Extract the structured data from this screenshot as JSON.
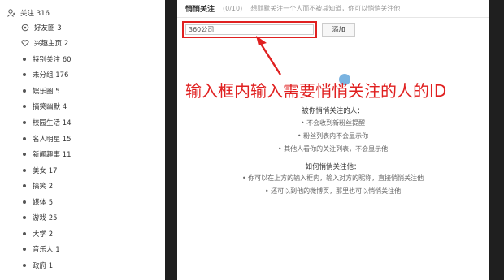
{
  "sidebar": {
    "top": {
      "label": "关注 316",
      "icon": "user-icon"
    },
    "items": [
      {
        "label": "好友圈 3",
        "icon": "circle-icon"
      },
      {
        "label": "兴趣主页 2",
        "icon": "heart-icon"
      },
      {
        "label": "特别关注 60",
        "icon": "dot-icon"
      },
      {
        "label": "未分组 176",
        "icon": "dot-icon"
      },
      {
        "label": "娱乐圈 5",
        "icon": "dot-icon"
      },
      {
        "label": "搞笑幽默 4",
        "icon": "dot-icon"
      },
      {
        "label": "校园生活 14",
        "icon": "dot-icon"
      },
      {
        "label": "名人明星 15",
        "icon": "dot-icon"
      },
      {
        "label": "新闻趣事 11",
        "icon": "dot-icon"
      },
      {
        "label": "美女 17",
        "icon": "dot-icon"
      },
      {
        "label": "搞笑 2",
        "icon": "dot-icon"
      },
      {
        "label": "媒体 5",
        "icon": "dot-icon"
      },
      {
        "label": "游戏 25",
        "icon": "dot-icon"
      },
      {
        "label": "大学 2",
        "icon": "dot-icon"
      },
      {
        "label": "音乐人 1",
        "icon": "dot-icon"
      },
      {
        "label": "政府 1",
        "icon": "dot-icon"
      }
    ]
  },
  "header": {
    "title": "悄悄关注",
    "count": "(0/10)",
    "desc": "想默默关注一个人而不被其知道，你可以悄悄关注他"
  },
  "input": {
    "value": "360公司"
  },
  "add_button": "添加",
  "annotation": "输入框内输入需要悄悄关注的人的ID",
  "info": {
    "heading1": "被你悄悄关注的人：",
    "lines1": [
      "• 不会收到新粉丝提醒",
      "• 粉丝列表内不会显示你",
      "• 其他人看你的关注列表，不会显示他"
    ],
    "heading2": "如何悄悄关注他：",
    "lines2": [
      "• 你可以在上方的输入框内，输入对方的昵称，直接悄悄关注他",
      "• 还可以到他的微博页，那里也可以悄悄关注他"
    ]
  },
  "colors": {
    "annotation_red": "#e02020",
    "dark_bg": "#1f1f1f"
  }
}
